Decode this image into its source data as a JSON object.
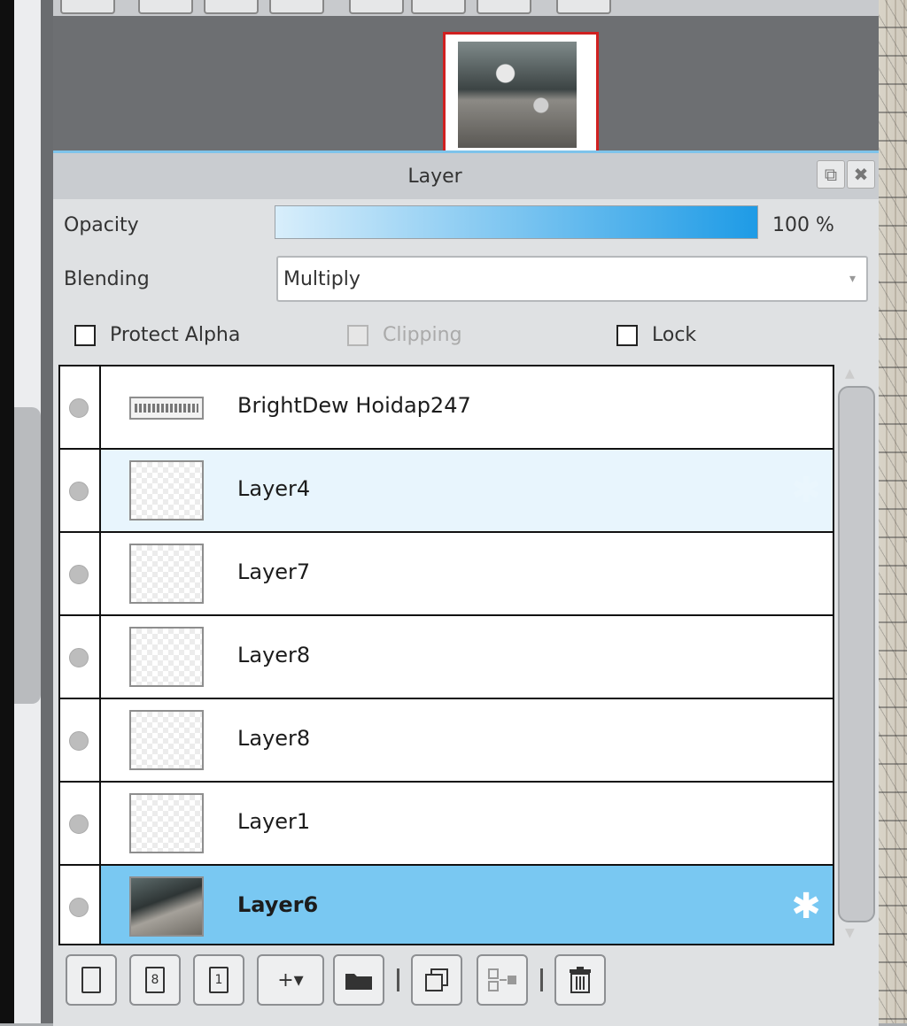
{
  "panel": {
    "title": "Layer",
    "opacity_label": "Opacity",
    "opacity_value": "100 %",
    "opacity_fraction": 1.0,
    "blending_label": "Blending",
    "blending_value": "Multiply",
    "protect_alpha_label": "Protect Alpha",
    "clipping_label": "Clipping",
    "lock_label": "Lock"
  },
  "layers": [
    {
      "name": "BrightDew Hoidap247",
      "state": "normal"
    },
    {
      "name": "Layer4",
      "state": "hover"
    },
    {
      "name": "Layer7",
      "state": "normal"
    },
    {
      "name": "Layer8",
      "state": "normal"
    },
    {
      "name": "Layer8",
      "state": "normal"
    },
    {
      "name": "Layer1",
      "state": "normal"
    },
    {
      "name": "Layer6",
      "state": "selected"
    }
  ],
  "toolbar": {
    "buttons": [
      {
        "icon": "new-layer-icon",
        "glyph": ""
      },
      {
        "icon": "new-8bit-layer-icon",
        "glyph": "8"
      },
      {
        "icon": "new-1bit-layer-icon",
        "glyph": "1"
      },
      {
        "icon": "add-layer-dropdown-icon",
        "glyph": "+▾"
      },
      {
        "icon": "folder-icon",
        "glyph": ""
      },
      {
        "icon": "duplicate-layer-icon",
        "glyph": ""
      },
      {
        "icon": "merge-down-icon",
        "glyph": ""
      },
      {
        "icon": "delete-layer-icon",
        "glyph": ""
      }
    ]
  },
  "colors": {
    "selected_row": "#79c8f2",
    "hover_row": "#e8f5fd",
    "navigator_frame": "#d02020",
    "opacity_accent": "#1e9be6"
  }
}
